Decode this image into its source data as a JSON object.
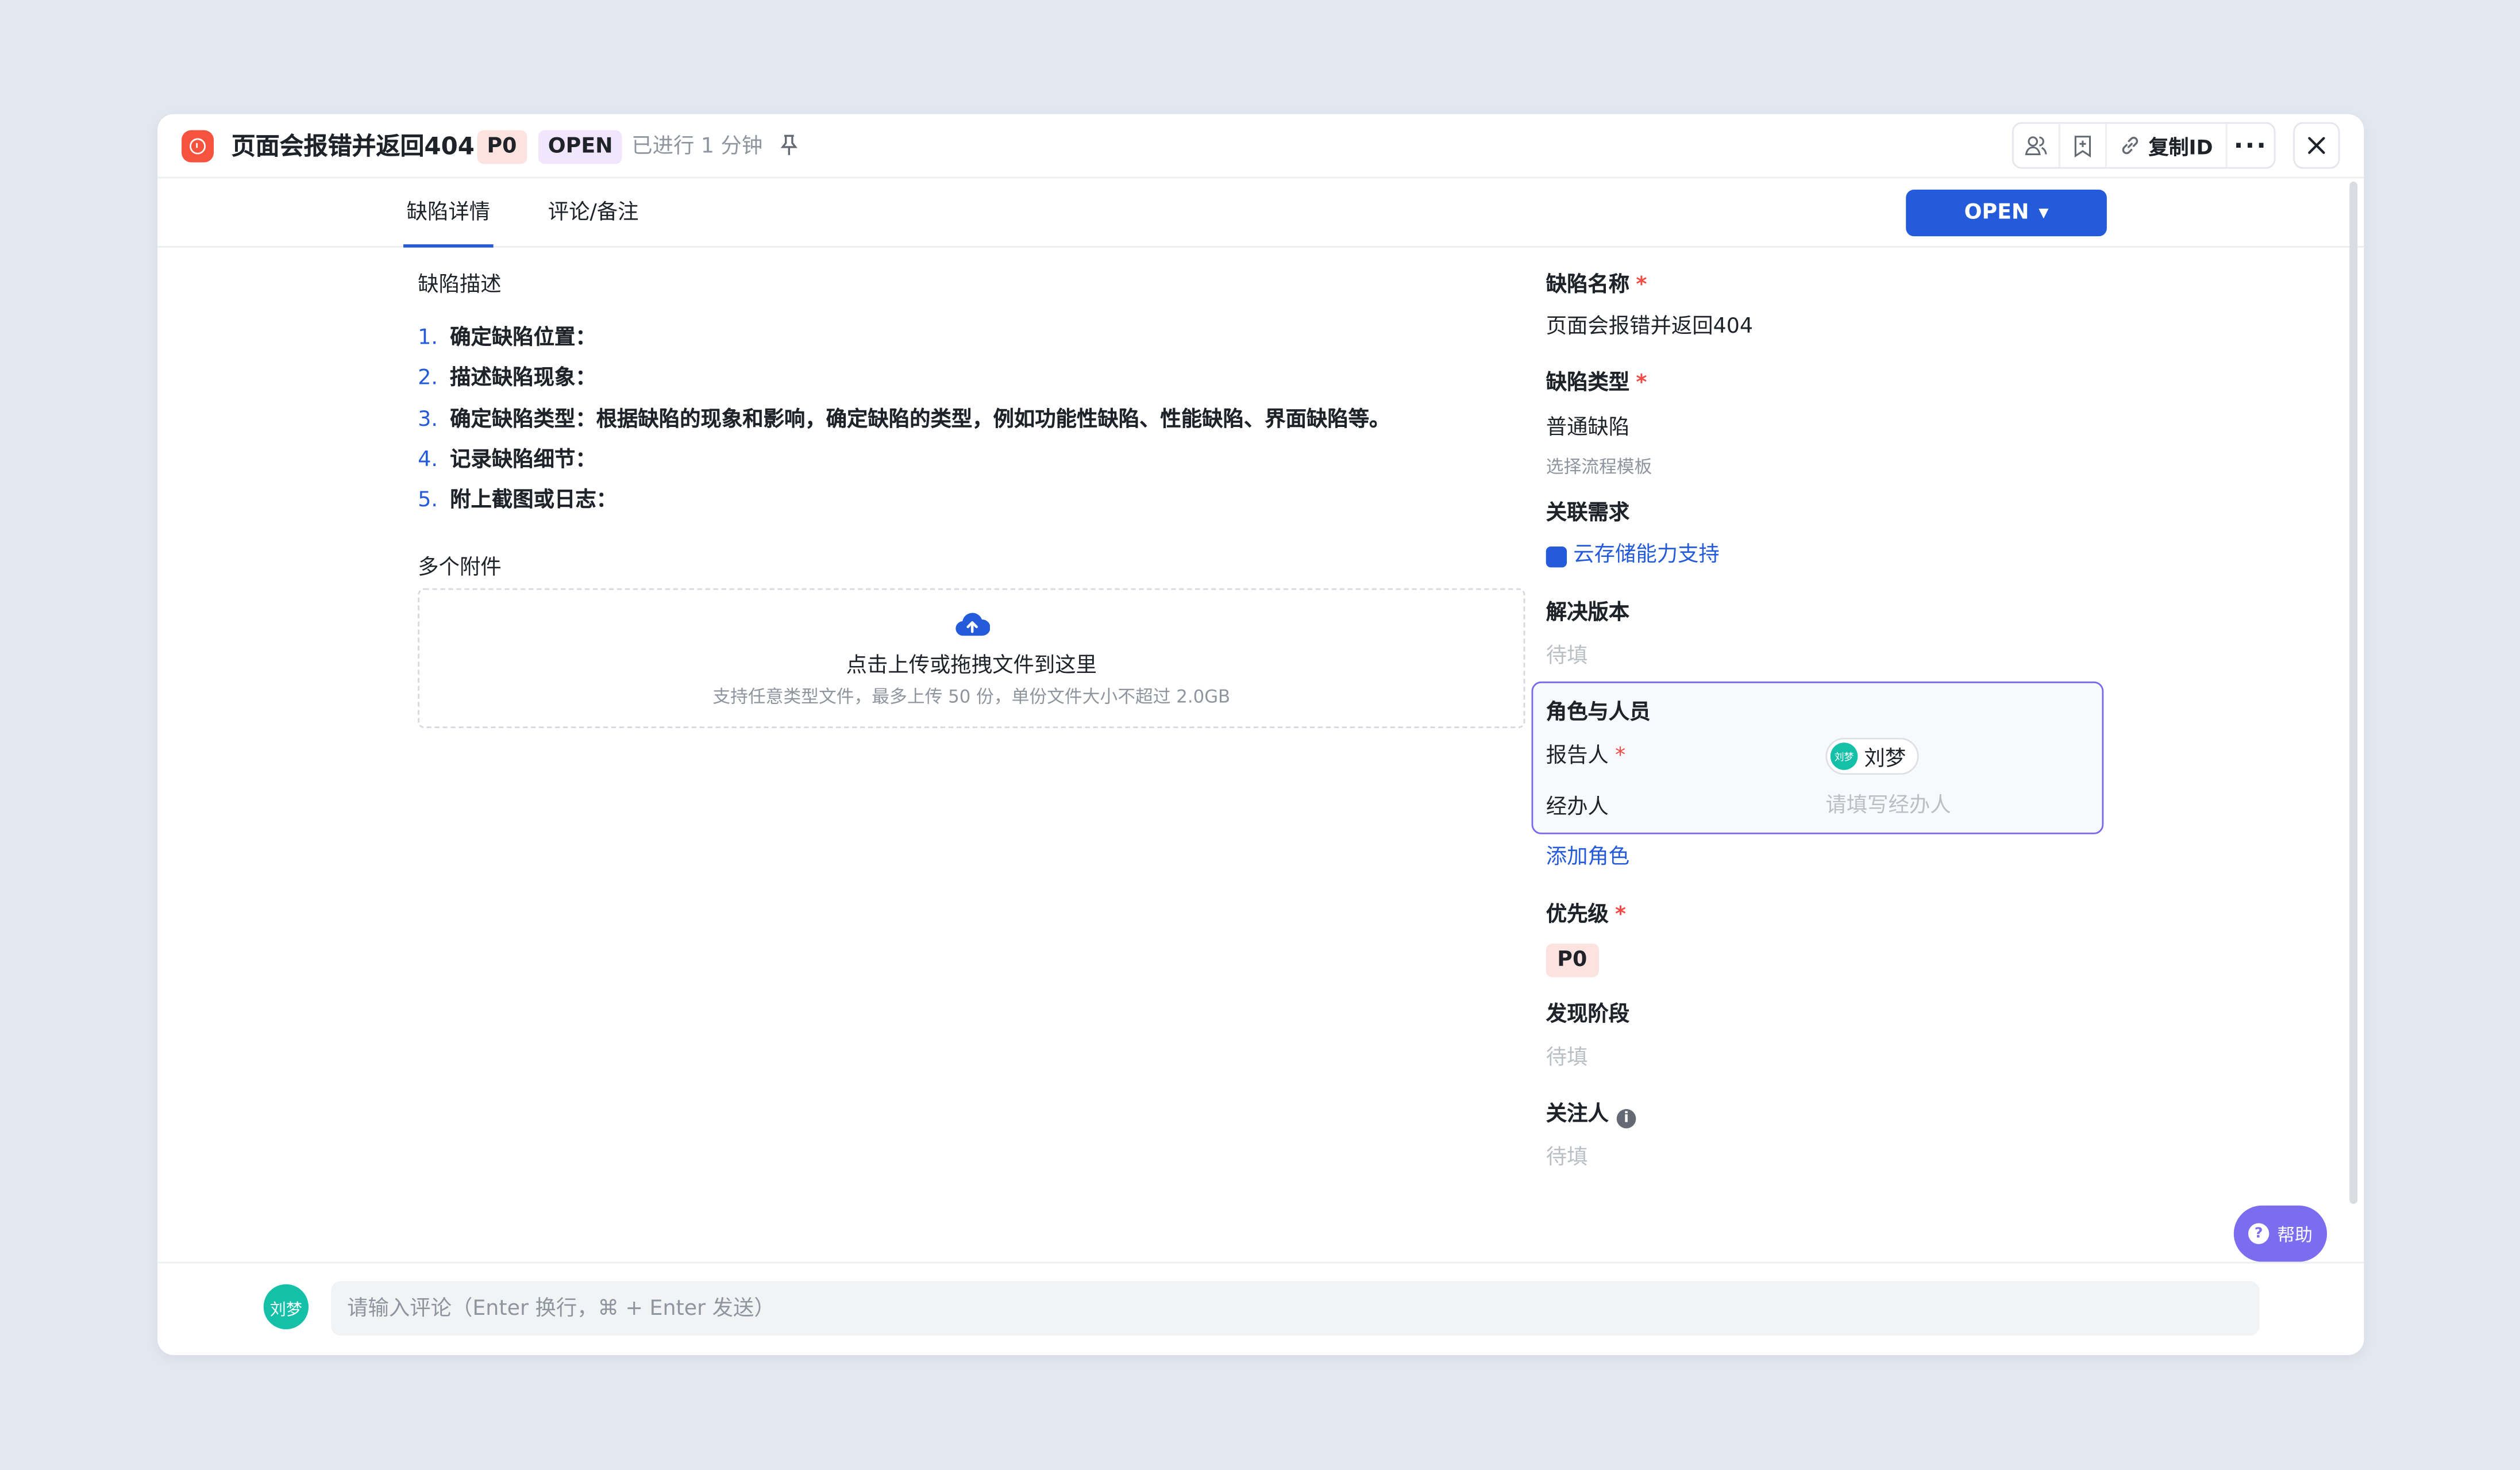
{
  "header": {
    "title": "页面会报错并返回404",
    "priority_tag": "P0",
    "status_tag": "OPEN",
    "elapsed": "已进行 1 分钟",
    "copy_id_label": "复制ID",
    "more_label": "···"
  },
  "tabs": [
    {
      "label": "缺陷详情",
      "active": true
    },
    {
      "label": "评论/备注",
      "active": false
    }
  ],
  "status_button": {
    "label": "OPEN",
    "caret": "▼"
  },
  "description": {
    "label": "缺陷描述",
    "items": [
      {
        "num": "1.",
        "text": "确定缺陷位置："
      },
      {
        "num": "2.",
        "text": "描述缺陷现象："
      },
      {
        "num": "3.",
        "text": "确定缺陷类型：根据缺陷的现象和影响，确定缺陷的类型，例如功能性缺陷、性能缺陷、界面缺陷等。"
      },
      {
        "num": "4.",
        "text": "记录缺陷细节："
      },
      {
        "num": "5.",
        "text": "附上截图或日志："
      }
    ]
  },
  "attachments": {
    "label": "多个附件",
    "upload_main": "点击上传或拖拽文件到这里",
    "upload_sub": "支持任意类型文件，最多上传 50 份，单份文件大小不超过 2.0GB"
  },
  "fields": {
    "name": {
      "label": "缺陷名称",
      "required": "*",
      "value": "页面会报错并返回404"
    },
    "type": {
      "label": "缺陷类型",
      "required": "*",
      "value": "普通缺陷",
      "hint": "选择流程模板"
    },
    "related": {
      "label": "关联需求",
      "value": "云存储能力支持"
    },
    "resolve_version": {
      "label": "解决版本",
      "value": "待填"
    },
    "roles": {
      "label": "角色与人员",
      "reporter_label": "报告人",
      "reporter_required": "*",
      "reporter_name": "刘梦",
      "reporter_avatar": "刘梦",
      "handler_label": "经办人",
      "handler_placeholder": "请填写经办人"
    },
    "add_role": "添加角色",
    "priority": {
      "label": "优先级",
      "required": "*",
      "value": "P0"
    },
    "found_stage": {
      "label": "发现阶段",
      "value": "待填"
    },
    "followers": {
      "label": "关注人",
      "info_icon": "i",
      "value": "待填"
    }
  },
  "help": {
    "label": "帮助",
    "icon": "?"
  },
  "footer": {
    "avatar_text": "刘梦",
    "comment_placeholder": "请输入评论（Enter 换行，⌘ + Enter 发送）"
  },
  "colors": {
    "accent": "#245bdb",
    "bug_icon": "#f5533d",
    "p0_bg": "#fde3e0",
    "open_bg": "#f1e6fc",
    "roles_border": "#7967ee",
    "help_bg": "#7b6cf0",
    "avatar": "#14c0a8"
  }
}
